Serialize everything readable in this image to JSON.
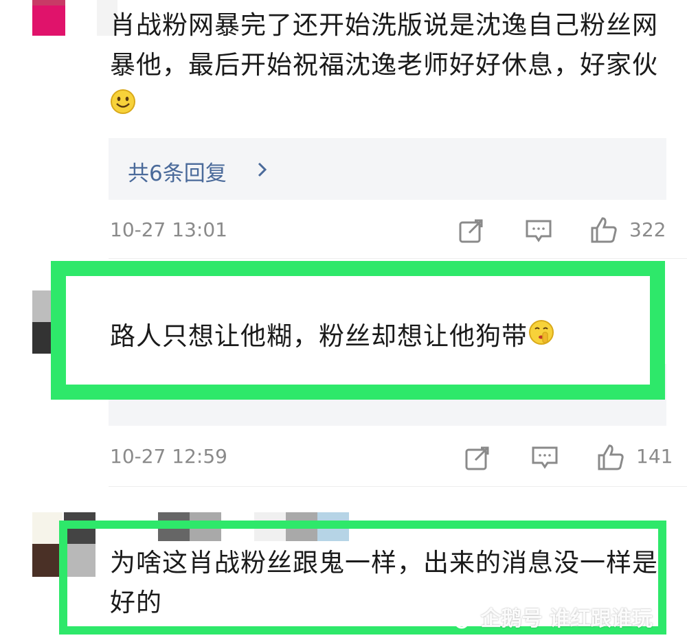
{
  "comments": [
    {
      "text": "肖战粉网暴完了还开始洗版说是沈逸自己粉丝网暴他，最后开始祝福沈逸老师好好休息，好家伙",
      "emoji": "smile",
      "reply_link": "共6条回复",
      "time": "10-27 13:01",
      "likes": "322"
    },
    {
      "text": "路人只想让他糊，粉丝却想让他狗带",
      "emoji": "shush",
      "time": "10-27 12:59",
      "likes": "141"
    },
    {
      "text": "为啥这肖战粉丝跟鬼一样，出来的消息没一样是好的"
    }
  ],
  "watermark": "企鹅号 谁红跟谁玩",
  "colors": {
    "highlight": "#2ee86a",
    "reply_link": "#4a6a9a",
    "meta": "#8a8a8a"
  },
  "icons": [
    "share-icon",
    "comment-icon",
    "like-icon",
    "chevron-right-icon"
  ]
}
